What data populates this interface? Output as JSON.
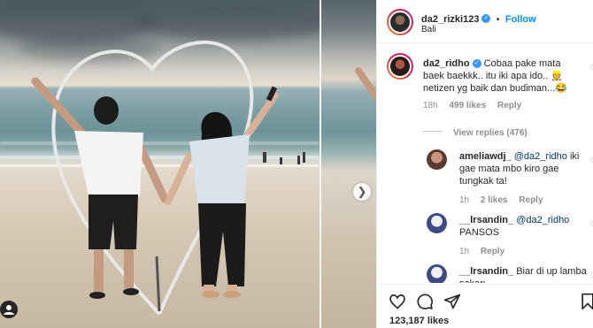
{
  "post": {
    "author": "da2_rizki123",
    "verified": true,
    "follow_label": "Follow",
    "separator": "•",
    "location": "Bali",
    "likes": "123,187 likes"
  },
  "comments": [
    {
      "username": "da2_ridho",
      "verified": true,
      "text": "Cobaa pake mata baek baekkk.. itu iki apa ido.. 👷 netizen yg baik dan budiman...😂",
      "time": "18h",
      "likes": "499 likes",
      "reply_label": "Reply",
      "view_replies": "View replies (476)",
      "replies": [
        {
          "username": "ameliawdj_",
          "mention": "@da2_ridho",
          "text": "iki gae mata mbo kiro gae tungkak ta!",
          "time": "1h",
          "likes": "2 likes",
          "reply_label": "Reply"
        },
        {
          "username": "__lrsandin_",
          "mention": "@da2_ridho",
          "text": "PANSOS",
          "time": "1h",
          "likes": "",
          "reply_label": "Reply"
        },
        {
          "username": "__lrsandin_",
          "mention": "",
          "text": "Biar di up lamba sakan",
          "time": "",
          "likes": "",
          "reply_label": ""
        }
      ]
    }
  ],
  "icons": {
    "heart": "heart-icon",
    "comment": "comment-icon",
    "share": "share-icon",
    "bookmark": "bookmark-icon",
    "next": "chevron-right-icon",
    "tag": "user-tag-icon"
  },
  "colors": {
    "link_blue": "#0095f6",
    "verified_blue": "#3897f0",
    "text": "#262626",
    "muted": "#8e8e8e"
  }
}
